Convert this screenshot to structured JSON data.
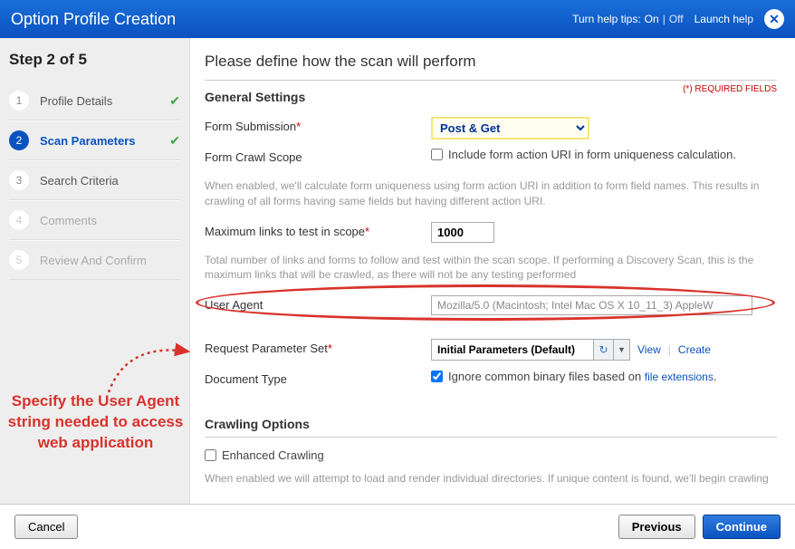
{
  "header": {
    "title": "Option Profile Creation",
    "help_label": "Turn help tips:",
    "on": "On",
    "off": "Off",
    "launch_help": "Launch help"
  },
  "wizard": {
    "heading": "Step 2 of 5",
    "steps": [
      {
        "num": "1",
        "label": "Profile Details",
        "done": true
      },
      {
        "num": "2",
        "label": "Scan Parameters",
        "done": true,
        "active": true
      },
      {
        "num": "3",
        "label": "Search Criteria"
      },
      {
        "num": "4",
        "label": "Comments"
      },
      {
        "num": "5",
        "label": "Review And Confirm"
      }
    ]
  },
  "annotation": "Specify the User Agent string needed to access web application",
  "main": {
    "title": "Please define how the scan will perform",
    "required_note": "(*) REQUIRED FIELDS",
    "sections": {
      "general": {
        "title": "General Settings",
        "form_submission": {
          "label": "Form Submission",
          "value": "Post & Get"
        },
        "form_crawl": {
          "label": "Form Crawl Scope",
          "checkbox": "Include form action URI in form uniqueness calculation."
        },
        "form_crawl_help": "When enabled, we'll calculate form uniqueness using form action URI in addition to form field names. This results in crawling of all forms having same fields but having different action URI.",
        "max_links": {
          "label": "Maximum links to test in scope",
          "value": "1000"
        },
        "max_links_help": "Total number of links and forms to follow and test within the scan scope. If performing a Discovery Scan, this is the maximum links that will be crawled, as there will not be any testing performed",
        "user_agent": {
          "label": "User Agent",
          "value": "Mozilla/5.0 (Macintosh; Intel Mac OS X 10_11_3) AppleW"
        },
        "param_set": {
          "label": "Request Parameter Set",
          "value": "Initial Parameters (Default)",
          "view": "View",
          "create": "Create"
        },
        "doc_type": {
          "label": "Document Type",
          "checkbox_pre": "Ignore common binary files based on ",
          "link": "file extensions",
          "checkbox_post": "."
        }
      },
      "crawling": {
        "title": "Crawling Options",
        "enhanced": "Enhanced Crawling",
        "enhanced_help": "When enabled we will attempt to load and render individual directories. If unique content is found, we'll begin crawling"
      }
    }
  },
  "footer": {
    "cancel": "Cancel",
    "previous": "Previous",
    "continue": "Continue"
  }
}
